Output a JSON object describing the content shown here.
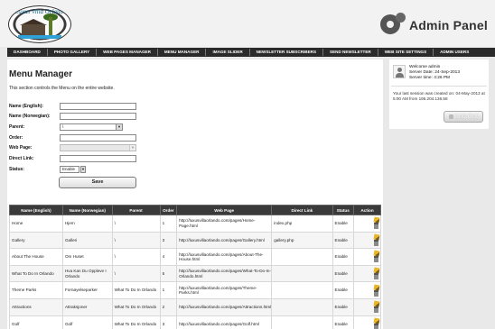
{
  "logo": {
    "text": "Luxus Villa Orlando"
  },
  "header": {
    "title": "Admin Panel"
  },
  "nav": [
    "DASHBOARD",
    "PHOTO GALLERY",
    "WEB PAGES MANAGER",
    "MENU MANAGER",
    "IMAGE SLIDER",
    "NEWSLETTER SUBSCRIBERS",
    "SEND NEWSLETTER",
    "WEB SITE SETTINGS",
    "ADMIN USERS"
  ],
  "page": {
    "title": "Menu Manager",
    "description": "This section controls the Menu on the entire website."
  },
  "form": {
    "name_en_label": "Name (English):",
    "name_no_label": "Name (Norwegian):",
    "parent_label": "Parent:",
    "parent_value": "\\",
    "order_label": "Order:",
    "webpage_label": "Web Page:",
    "direct_link_label": "Direct Link:",
    "status_label": "Status:",
    "status_value": "Enable",
    "save_label": "Save"
  },
  "table": {
    "headers": [
      "Name (English)",
      "Name (Norwegian)",
      "Parent",
      "Order",
      "Web Page",
      "Direct Link",
      "Status",
      "Action"
    ],
    "rows": [
      {
        "name_en": "Home",
        "name_no": "Hjem",
        "parent": "\\",
        "order": "1",
        "webpage": "http://luxusvillaorlando.com/pages/Home-Page.html",
        "direct_link": "index.php",
        "status": "Enable"
      },
      {
        "name_en": "Gallery",
        "name_no": "Galleri",
        "parent": "\\",
        "order": "3",
        "webpage": "http://luxusvillaorlando.com/pages/Gallery.html",
        "direct_link": "gallery.php",
        "status": "Enable"
      },
      {
        "name_en": "About The House",
        "name_no": "Om Huset",
        "parent": "\\",
        "order": "4",
        "webpage": "http://luxusvillaorlando.com/pages/About-The-House.html",
        "direct_link": "",
        "status": "Enable"
      },
      {
        "name_en": "What To Do In Orlando",
        "name_no": "Hva Kan Du Oppleve I Orlando",
        "parent": "\\",
        "order": "5",
        "webpage": "http://luxusvillaorlando.com/pages/What-To-Do-In-Orlando.html",
        "direct_link": "",
        "status": "Enable"
      },
      {
        "name_en": "Theme Parks",
        "name_no": "Fornøyelseparker",
        "parent": "What To Do In Orlando",
        "order": "1",
        "webpage": "http://luxusvillaorlando.com/pages/Theme-Parks.html",
        "direct_link": "",
        "status": "Enable"
      },
      {
        "name_en": "Attractions",
        "name_no": "Attraksjoner",
        "parent": "What To Do In Orlando",
        "order": "2",
        "webpage": "http://luxusvillaorlando.com/pages/Attractions.html",
        "direct_link": "",
        "status": "Enable"
      },
      {
        "name_en": "Golf",
        "name_no": "Golf",
        "parent": "What To Do In Orlando",
        "order": "3",
        "webpage": "http://luxusvillaorlando.com/pages/Golf.html",
        "direct_link": "",
        "status": "Enable"
      }
    ]
  },
  "sidebar": {
    "welcome": "Welcome admin",
    "server_date": "Server Date: 24-Sep-2013",
    "server_time": "Server time: 4:26 PM",
    "last_session": "Your last session was created on: 04-May-2013 at 5:00 AM from 195.204.136.58",
    "logout_label": "Log Out"
  },
  "colors": {
    "nav_bg": "#2a2a2a",
    "table_header_bg": "#3a3a3a",
    "page_bg": "#e9e9e9"
  }
}
